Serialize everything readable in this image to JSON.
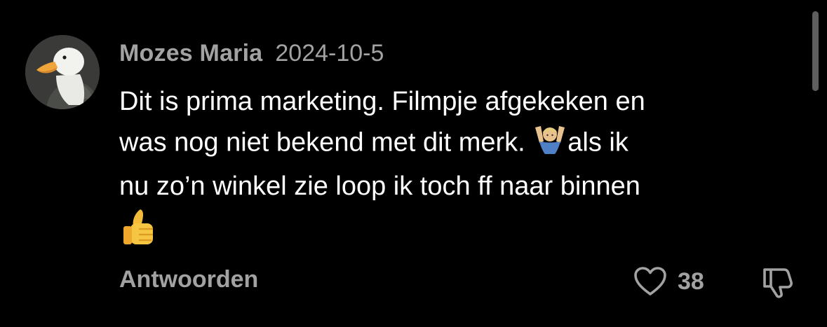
{
  "comment": {
    "author": "Mozes Maria",
    "date": "2024-10-5",
    "lines": [
      "Dit is prima marketing. Filmpje afgekeken en",
      "was nog niet bekend met dit merk. ",
      "als ik",
      "nu zo’n winkel zie loop ik toch ff naar binnen"
    ],
    "emojis": [
      "shrug-person-emoji",
      "thumbs-up-emoji"
    ],
    "reply_label": "Antwoorden",
    "like_count": "38"
  },
  "icons": {
    "avatar": "duck-avatar",
    "like": "heart-outline-icon",
    "dislike": "thumbs-down-outline-icon"
  },
  "colors": {
    "background": "#000000",
    "text": "#ffffff",
    "muted": "#a2a2a2",
    "scrollbar": "#5e5e5e"
  }
}
